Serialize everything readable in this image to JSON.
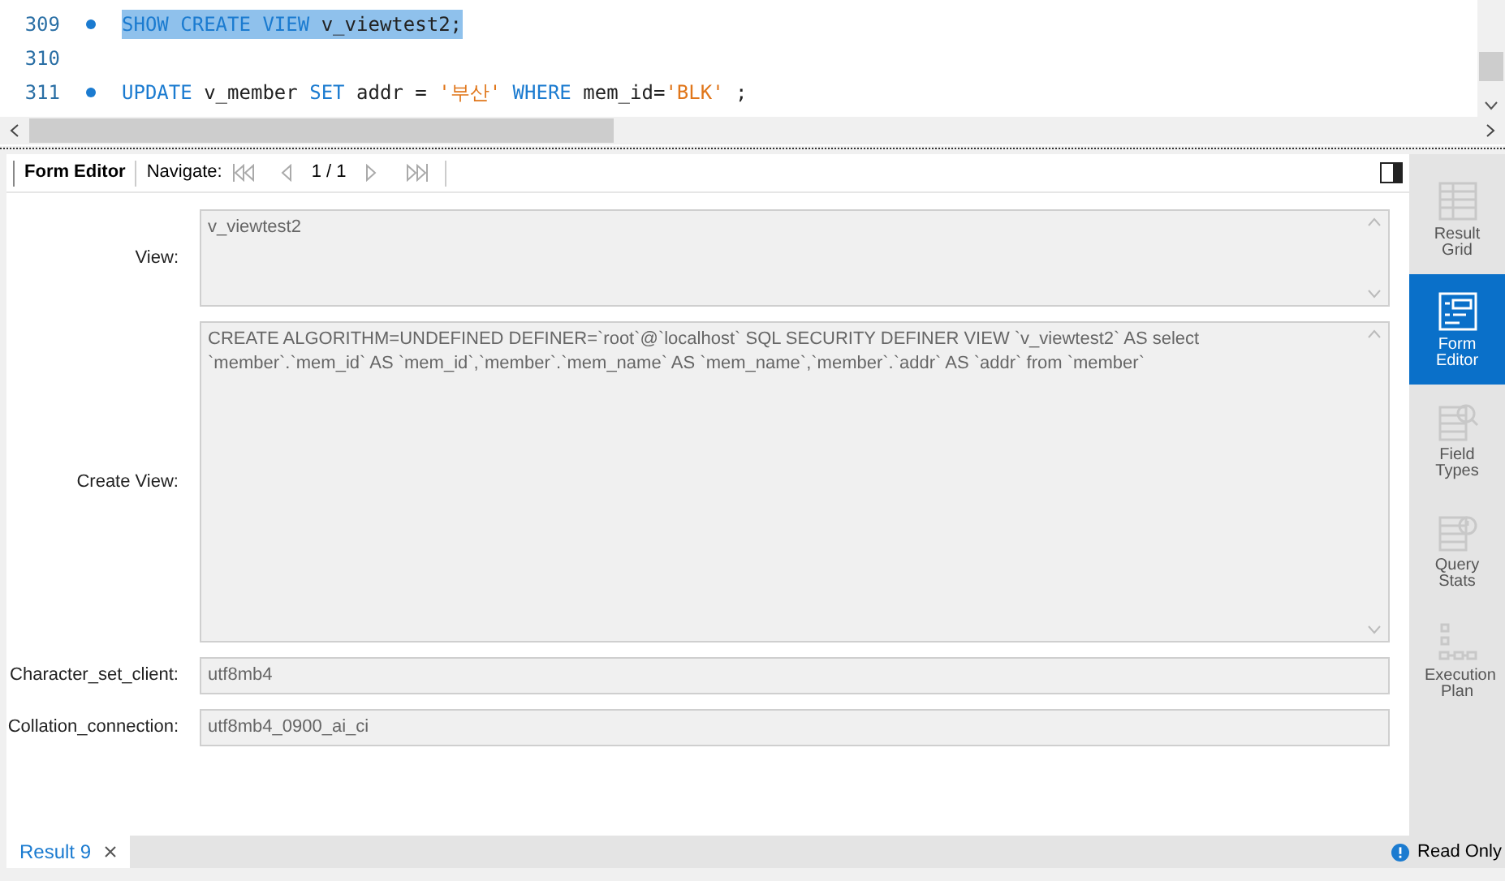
{
  "editor": {
    "lines": [
      {
        "number": "309",
        "selected": true,
        "tokens": [
          {
            "text": "SHOW CREATE VIEW",
            "kind": "keyword"
          },
          {
            "text": " v_viewtest2;",
            "kind": "plain"
          }
        ]
      },
      {
        "number": "310"
      },
      {
        "number": "311",
        "selected": false,
        "tokens": [
          {
            "text": "UPDATE",
            "kind": "keyword"
          },
          {
            "text": " v_member ",
            "kind": "plain"
          },
          {
            "text": "SET",
            "kind": "keyword"
          },
          {
            "text": " addr = ",
            "kind": "plain"
          },
          {
            "text": "'부산'",
            "kind": "string"
          },
          {
            "text": " WHERE",
            "kind": "keyword"
          },
          {
            "text": " mem_id=",
            "kind": "plain"
          },
          {
            "text": "'BLK'",
            "kind": "string"
          },
          {
            "text": " ;",
            "kind": "plain"
          }
        ]
      }
    ]
  },
  "toolbar": {
    "title": "Form Editor",
    "navigate_label": "Navigate:",
    "page": "1 / 1"
  },
  "form": {
    "fields": [
      {
        "label": "View:",
        "value": "v_viewtest2",
        "kind": "multiline"
      },
      {
        "label": "Create View:",
        "value": "CREATE ALGORITHM=UNDEFINED DEFINER=`root`@`localhost` SQL SECURITY DEFINER VIEW `v_viewtest2` AS select `member`.`mem_id` AS `mem_id`,`member`.`mem_name` AS `mem_name`,`member`.`addr` AS `addr` from `member`",
        "kind": "large"
      },
      {
        "label": "Character_set_client:",
        "value": "utf8mb4",
        "kind": "single"
      },
      {
        "label": "Collation_connection:",
        "value": "utf8mb4_0900_ai_ci",
        "kind": "single"
      }
    ]
  },
  "sidebar": {
    "items": [
      {
        "label": "Result Grid",
        "selected": false,
        "kind": "grid"
      },
      {
        "label": "Form Editor",
        "selected": true,
        "kind": "form"
      },
      {
        "label": "Field Types",
        "selected": false,
        "kind": "types"
      },
      {
        "label": "Query Stats",
        "selected": false,
        "kind": "stats"
      },
      {
        "label": "Execution Plan",
        "selected": false,
        "kind": "plan"
      }
    ]
  },
  "status_bar": {
    "tab": "Result 9",
    "read_only": "Read Only"
  }
}
